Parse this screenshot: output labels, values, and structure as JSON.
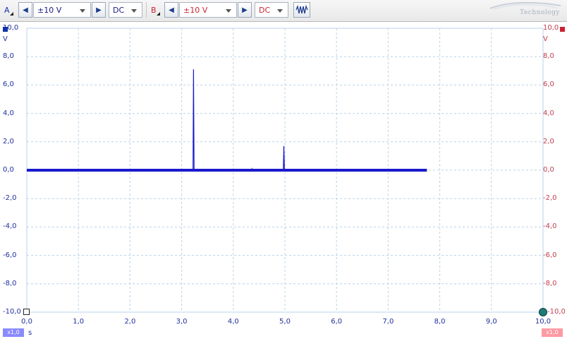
{
  "toolbar": {
    "channel_a": {
      "label": "A",
      "range": "±10 V",
      "coupling": "DC",
      "color": "#1133aa"
    },
    "channel_b": {
      "label": "B",
      "range": "±10 V",
      "coupling": "DC",
      "color": "#cc2233"
    },
    "step_left_glyph": "◀",
    "step_right_glyph": "▶",
    "signal_icon": "signal-generator-icon",
    "brand_text": "Technology"
  },
  "plot": {
    "left_axis_labels": [
      "10,0",
      "8,0",
      "6,0",
      "4,0",
      "2,0",
      "0,0",
      "-2,0",
      "-4,0",
      "-6,0",
      "-8,0",
      "-10,0"
    ],
    "right_axis_labels": [
      "10,0",
      "8,0",
      "6,0",
      "4,0",
      "2,0",
      "0,0",
      "-2,0",
      "-4,0",
      "-6,0",
      "-8,0",
      "-10,0"
    ],
    "left_unit": "V",
    "right_unit": "V",
    "x_axis_labels": [
      "0,0",
      "1,0",
      "2,0",
      "3,0",
      "4,0",
      "5,0",
      "6,0",
      "7,0",
      "8,0",
      "9,0",
      "10,0"
    ],
    "x_unit": "s",
    "mult_a": "x1,0",
    "mult_b": "x1,0"
  },
  "chart_data": {
    "type": "line",
    "xlim": [
      0,
      10
    ],
    "ylim": [
      -10,
      10
    ],
    "grid": true,
    "series": [
      {
        "color": "#1a1acc",
        "x": [
          0.0,
          3.22,
          3.23,
          3.24,
          3.25,
          4.35,
          4.36,
          4.37,
          4.97,
          4.98,
          4.99,
          7.75
        ],
        "values": [
          0.0,
          0.0,
          7.1,
          0.0,
          0.0,
          0.0,
          0.1,
          0.0,
          0.0,
          1.7,
          0.0,
          0.0
        ]
      }
    ]
  }
}
